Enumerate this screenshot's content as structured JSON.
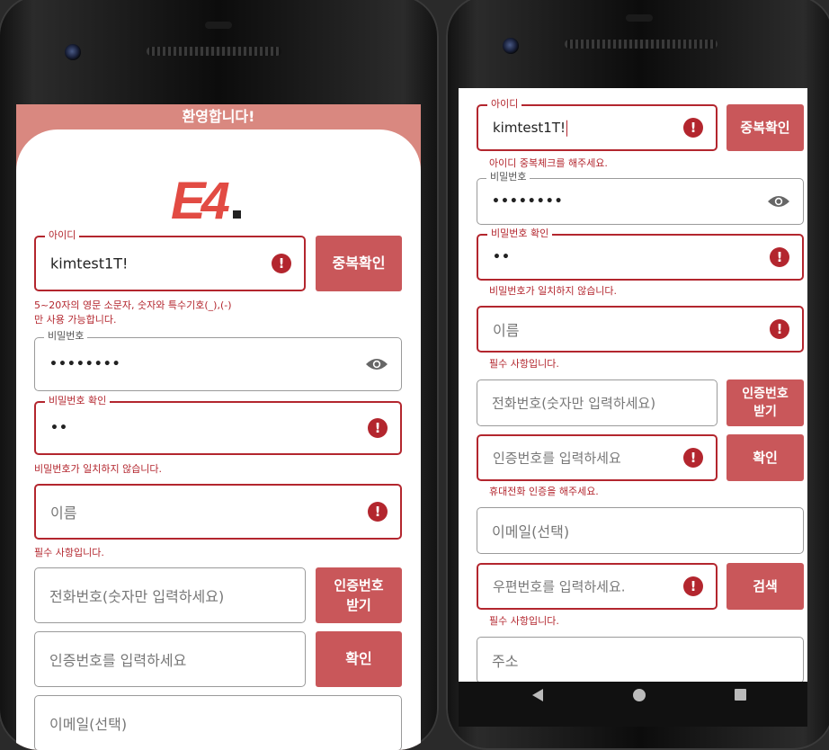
{
  "left_screen": {
    "welcome": "환영합니다!",
    "logo": "E4",
    "id_field": {
      "label": "아이디",
      "value": "kimtest1T!"
    },
    "dup_check_label": "중복확인",
    "id_helper_line1": "5~20자의 영문 소문자, 숫자와 특수기호(_),(-)",
    "id_helper_line2": "만 사용 가능합니다.",
    "password_field": {
      "label": "비밀번호",
      "value": "••••••••"
    },
    "password_confirm_field": {
      "label": "비밀번호 확인",
      "value": "••"
    },
    "password_mismatch": "비밀번호가 일치하지 않습니다.",
    "name_field": {
      "placeholder": "이름"
    },
    "required_msg": "필수 사항입니다.",
    "phone_field": {
      "placeholder": "전화번호(숫자만 입력하세요)"
    },
    "send_code_line1": "인증번호",
    "send_code_line2": "받기",
    "code_field": {
      "placeholder": "인증번호를 입력하세요"
    },
    "confirm_label": "확인",
    "email_field": {
      "placeholder": "이메일(선택)"
    }
  },
  "right_screen": {
    "id_field": {
      "label": "아이디",
      "value": "kimtest1T!"
    },
    "dup_check_label": "중복확인",
    "id_helper": "아이디 중복체크를 해주세요.",
    "password_field": {
      "label": "비밀번호",
      "value": "••••••••"
    },
    "password_confirm_field": {
      "label": "비밀번호 확인",
      "value": "••"
    },
    "password_mismatch": "비밀번호가 일치하지 않습니다.",
    "name_field": {
      "placeholder": "이름"
    },
    "required_msg": "필수 사항입니다.",
    "phone_field": {
      "placeholder": "전화번호(숫자만 입력하세요)"
    },
    "send_code_line1": "인증번호",
    "send_code_line2": "받기",
    "code_field": {
      "placeholder": "인증번호를 입력하세요"
    },
    "confirm_label": "확인",
    "phone_verify_msg": "휴대전화 인증을 해주세요.",
    "email_field": {
      "placeholder": "이메일(선택)"
    },
    "postal_field": {
      "placeholder": "우편번호를 입력하세요."
    },
    "search_label": "검색",
    "postal_required_msg": "필수 사항입니다.",
    "address_field": {
      "placeholder": "주소"
    }
  },
  "colors": {
    "accent": "#c9575a",
    "error": "#b3262e",
    "header": "#d98880",
    "logo": "#e24b43"
  }
}
